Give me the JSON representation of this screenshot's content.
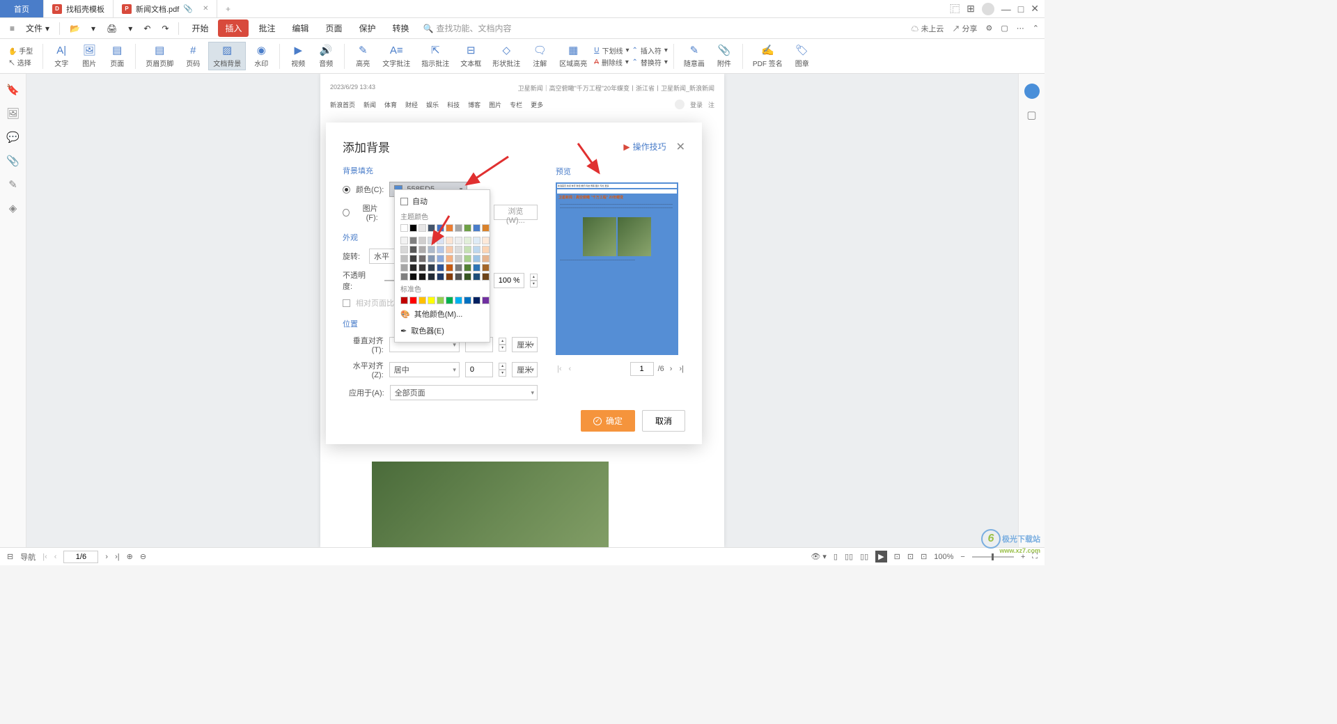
{
  "tabs": {
    "home": "首页",
    "template": "找稻壳模板",
    "doc": "新闻文档.pdf"
  },
  "menu": {
    "file": "文件",
    "start": "开始",
    "insert": "插入",
    "annot": "批注",
    "edit": "编辑",
    "page": "页面",
    "protect": "保护",
    "convert": "转换",
    "search_ph": "查找功能、文档内容",
    "cloud": "未上云",
    "share": "分享"
  },
  "mode": {
    "hand": "手型",
    "select": "选择"
  },
  "ribbon": {
    "text": "文字",
    "image": "图片",
    "page": "页面",
    "header": "页眉页脚",
    "pagenum": "页码",
    "docbg": "文档背景",
    "watermark": "水印",
    "video": "视频",
    "audio": "音频",
    "highlight": "高亮",
    "textannot": "文字批注",
    "pointannot": "指示批注",
    "textbox": "文本框",
    "shapeannot": "形状批注",
    "note": "注解",
    "areahighlight": "区域高亮",
    "underline": "下划线",
    "strikeout": "删除线",
    "insertsym": "插入符",
    "replacesym": "替换符",
    "freedraw": "随意画",
    "attach": "附件",
    "pdfsign": "PDF 签名",
    "stamp": "图章"
  },
  "doc": {
    "timestamp": "2023/6/29 13:43",
    "title_full": "卫星新闻｜高空俯瞰\"千万工程\"20年蝶变丨浙江省丨卫星新闻_新浪新闻",
    "nav": [
      "新浪首页",
      "新闻",
      "体育",
      "财经",
      "娱乐",
      "科技",
      "博客",
      "图片",
      "专栏",
      "更多"
    ],
    "login": "登录",
    "reg": "注"
  },
  "dialog": {
    "title": "添加背景",
    "tips": "操作技巧",
    "sec_fill": "背景填充",
    "sec_look": "外观",
    "sec_pos": "位置",
    "color_lbl": "颜色(C):",
    "color_val": "558ED5",
    "image_lbl": "图片(F):",
    "browse": "浏览(W)...",
    "rotate_lbl": "旋转:",
    "rotate_val": "水平",
    "opacity_lbl": "不透明度:",
    "opacity_val": "100 %",
    "relative_cb": "相对页面比",
    "valign_lbl": "垂直对齐(T):",
    "unit": "厘米",
    "halign_lbl": "水平对齐(Z):",
    "halign_val": "居中",
    "halign_num": "0",
    "apply_lbl": "应用于(A):",
    "apply_val": "全部页面",
    "preview": "预览",
    "page_current": "1",
    "page_total": "/6",
    "ok": "确定",
    "cancel": "取消"
  },
  "colordd": {
    "auto": "自动",
    "theme": "主题颜色",
    "standard": "标准色",
    "more": "其他颜色(M)...",
    "picker": "取色器(E)",
    "row1": [
      "#ffffff",
      "#000000",
      "#e7e6e6",
      "#44546a",
      "#4472c4",
      "#ed7d31",
      "#a5a5a5",
      "#6ea046",
      "#4a7dc9",
      "#d9822b"
    ],
    "rows": [
      [
        "#f2f2f2",
        "#7f7f7f",
        "#d0cece",
        "#d6dce4",
        "#d9e2f3",
        "#fbe5d5",
        "#ededed",
        "#e2efd9",
        "#deebf6",
        "#fde9d9"
      ],
      [
        "#d8d8d8",
        "#595959",
        "#aeabab",
        "#adb9ca",
        "#b4c6e7",
        "#f7caac",
        "#dbdbdb",
        "#c5e0b3",
        "#bdd7ee",
        "#fbd4b4"
      ],
      [
        "#bfbfbf",
        "#3f3f3f",
        "#757070",
        "#8496b0",
        "#8eaadb",
        "#f4b183",
        "#c9c9c9",
        "#a8d08d",
        "#9cc3e5",
        "#e7b58f"
      ],
      [
        "#a5a5a5",
        "#262626",
        "#3a3838",
        "#323f4f",
        "#2f5496",
        "#c55a11",
        "#7b7b7b",
        "#538135",
        "#2e75b5",
        "#a46628"
      ],
      [
        "#7f7f7f",
        "#0c0c0c",
        "#171616",
        "#222a35",
        "#1f3864",
        "#833c0b",
        "#525252",
        "#375623",
        "#1e4e79",
        "#6d4419"
      ]
    ],
    "std": [
      "#c00000",
      "#ff0000",
      "#ffc000",
      "#ffff00",
      "#92d050",
      "#00b050",
      "#00b0f0",
      "#0070c0",
      "#002060",
      "#7030a0"
    ]
  },
  "status": {
    "nav": "导航",
    "page": "1/6",
    "zoom": "100%"
  },
  "watermark": {
    "brand": "极光下载站",
    "url": "www.xz7.com"
  },
  "preview_headline": "卫星新闻｜高空俯瞰 \"千万工程\" 20年蝶变"
}
